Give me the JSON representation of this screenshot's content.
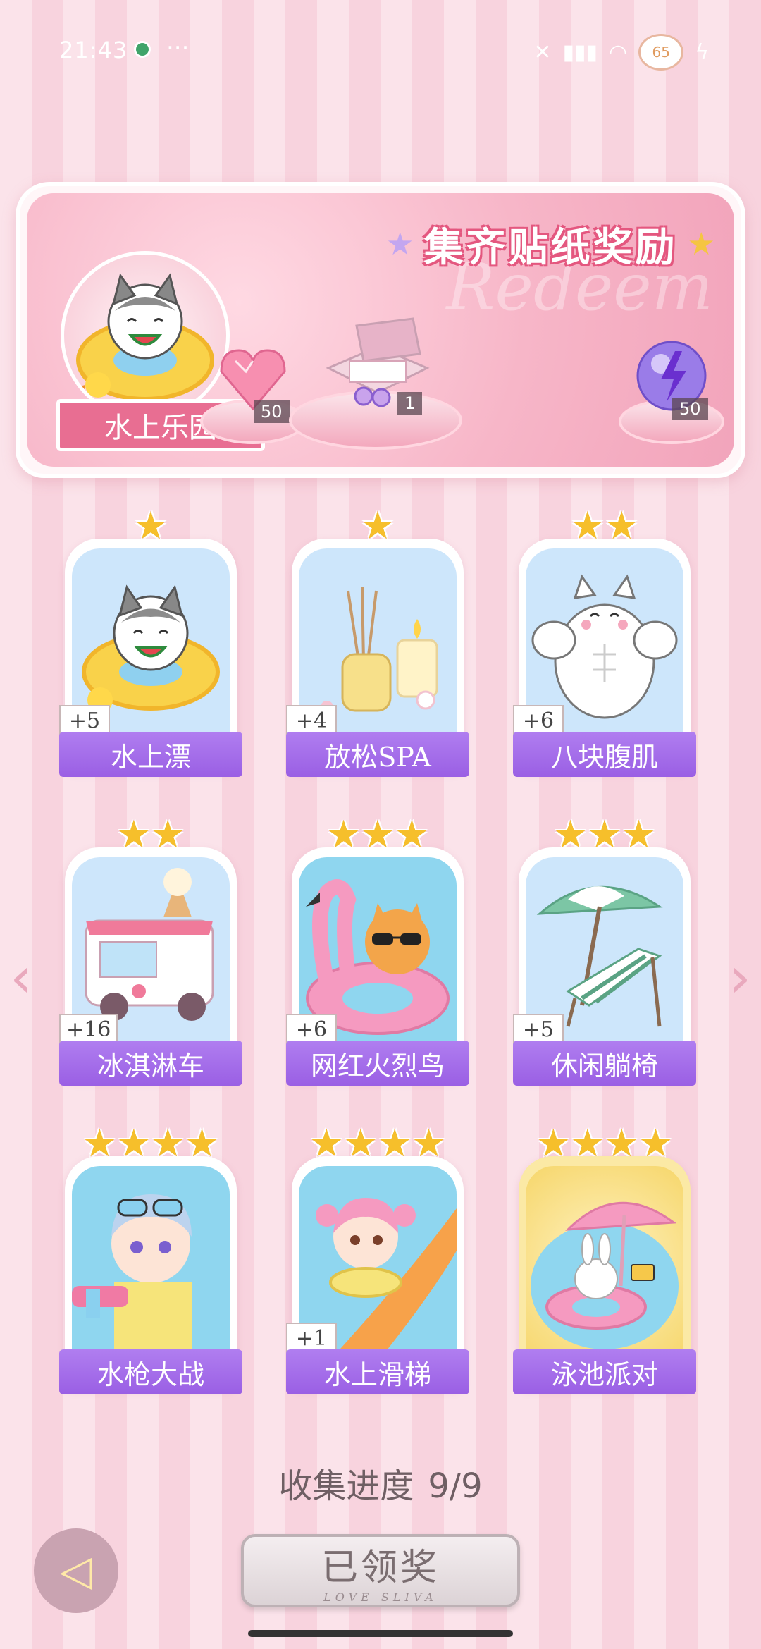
{
  "status_bar": {
    "time": "21:43",
    "dots": "···",
    "battery": "65",
    "icons": [
      "mute-icon",
      "signal-icon",
      "wifi-icon",
      "battery-icon",
      "charging-icon"
    ]
  },
  "banner": {
    "title": "集齐贴纸奖励",
    "watermark": "Redeem",
    "album_name": "水上乐园",
    "rewards": [
      {
        "icon": "pink-diamond-icon",
        "count": "50"
      },
      {
        "icon": "gift-box-icon",
        "count": "1"
      },
      {
        "icon": "energy-orb-icon",
        "count": "50"
      }
    ]
  },
  "stickers": [
    {
      "name": "水上漂",
      "stars": "★",
      "badge": "+5",
      "art": "cat-float"
    },
    {
      "name": "放松SPA",
      "stars": "★",
      "badge": "+4",
      "art": "spa"
    },
    {
      "name": "八块腹肌",
      "stars": "★★",
      "badge": "+6",
      "art": "muscle-cat"
    },
    {
      "name": "冰淇淋车",
      "stars": "★★",
      "badge": "+16",
      "art": "ice-cream-truck"
    },
    {
      "name": "网红火烈鸟",
      "stars": "★★★",
      "badge": "+6",
      "art": "flamingo"
    },
    {
      "name": "休闲躺椅",
      "stars": "★★★",
      "badge": "+5",
      "art": "beach-chair"
    },
    {
      "name": "水枪大战",
      "stars": "★★★★",
      "badge": "",
      "art": "water-gun"
    },
    {
      "name": "水上滑梯",
      "stars": "★★★★",
      "badge": "+1",
      "art": "water-slide"
    },
    {
      "name": "泳池派对",
      "stars": "★★★★",
      "badge": "",
      "art": "pool-party"
    }
  ],
  "progress": {
    "label": "收集进度",
    "value": "9/9"
  },
  "claim_button": {
    "label": "已领奖",
    "subtitle": "LOVE SLIVA"
  },
  "nav": {
    "prev": "‹",
    "next": "›"
  }
}
